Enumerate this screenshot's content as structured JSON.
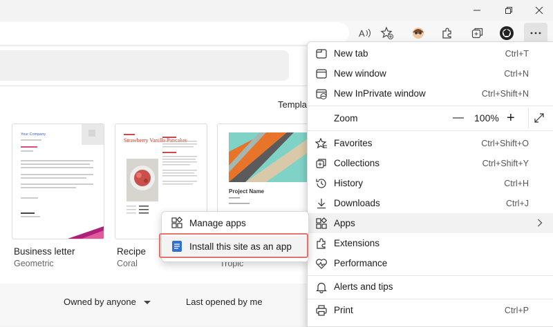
{
  "window": {
    "minimize_icon": "minimize-icon",
    "restore_icon": "restore-icon",
    "close_icon": "close-icon"
  },
  "toolbar": {
    "read_aloud_icon": "read-aloud-icon",
    "favorites_icon": "add-favorite-icon",
    "profile_icon": "avatar-icon",
    "extensions_icon": "extensions-icon",
    "collections_icon": "collections-icon",
    "more_icon": "more-icon"
  },
  "page": {
    "templates_label": "Templa",
    "cards": [
      {
        "title": "Business letter",
        "subtitle": "Geometric",
        "thumb_heading": "Your Company"
      },
      {
        "title": "Recipe",
        "subtitle": "Coral",
        "thumb_heading": "Strawberry Vanilla Pancakes"
      },
      {
        "title": "",
        "subtitle": "Tropic",
        "thumb_heading": "Project Name"
      }
    ],
    "owner_filter": "Owned by anyone",
    "sort_filter": "Last opened by me"
  },
  "menu": {
    "items": [
      {
        "label": "New tab",
        "shortcut": "Ctrl+T",
        "icon": "new-tab-icon"
      },
      {
        "label": "New window",
        "shortcut": "Ctrl+N",
        "icon": "new-window-icon"
      },
      {
        "label": "New InPrivate window",
        "shortcut": "Ctrl+Shift+N",
        "icon": "inprivate-icon"
      },
      {
        "label": "Favorites",
        "shortcut": "Ctrl+Shift+O",
        "icon": "favorites-icon"
      },
      {
        "label": "Collections",
        "shortcut": "Ctrl+Shift+Y",
        "icon": "collections-icon"
      },
      {
        "label": "History",
        "shortcut": "Ctrl+H",
        "icon": "history-icon"
      },
      {
        "label": "Downloads",
        "shortcut": "Ctrl+J",
        "icon": "downloads-icon"
      },
      {
        "label": "Apps",
        "shortcut": "",
        "icon": "apps-icon"
      },
      {
        "label": "Extensions",
        "shortcut": "",
        "icon": "extensions-icon"
      },
      {
        "label": "Performance",
        "shortcut": "",
        "icon": "performance-icon"
      },
      {
        "label": "Alerts and tips",
        "shortcut": "",
        "icon": "bell-icon"
      },
      {
        "label": "Print",
        "shortcut": "Ctrl+P",
        "icon": "print-icon"
      }
    ],
    "zoom": {
      "label": "Zoom",
      "value": "100%",
      "minus": "—",
      "plus": "+"
    }
  },
  "submenu": {
    "items": [
      {
        "label": "Manage apps",
        "icon": "manage-apps-icon"
      },
      {
        "label": "Install this site as an app",
        "icon": "install-app-icon"
      }
    ]
  },
  "colors": {
    "accent": "#2f6fd6",
    "highlight_box": "#e2736a"
  }
}
